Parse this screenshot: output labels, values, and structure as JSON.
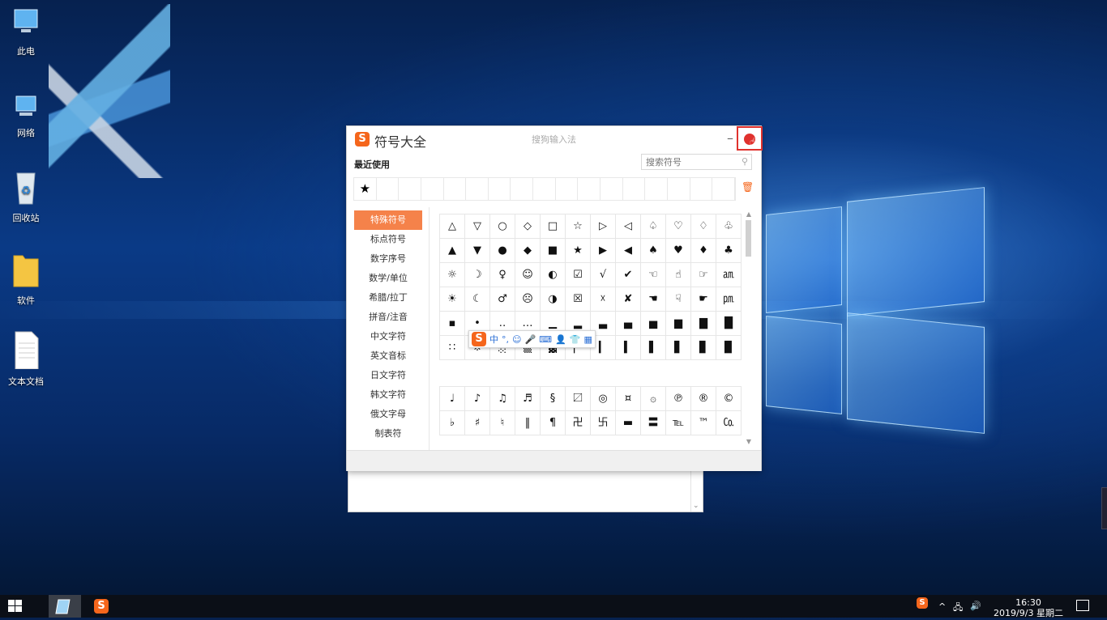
{
  "desktop": {
    "icons": [
      {
        "label": "此电",
        "icon": "computer-icon"
      },
      {
        "label": "网络",
        "icon": "network-icon"
      },
      {
        "label": "回收站",
        "icon": "recycle-bin-icon"
      },
      {
        "label": "软件",
        "icon": "folder-icon"
      },
      {
        "label": "文本文档",
        "icon": "text-document-icon"
      }
    ]
  },
  "dialog": {
    "title": "符号大全",
    "subtitle": "搜狗输入法",
    "logo_letter": "S",
    "minimize": "–",
    "recent_label": "最近使用",
    "search_placeholder": "搜索符号",
    "recent_symbols": [
      "★",
      "",
      "",
      "",
      "",
      "",
      "",
      "",
      "",
      "",
      "",
      "",
      "",
      "",
      "",
      "",
      ""
    ],
    "categories": [
      "特殊符号",
      "标点符号",
      "数字序号",
      "数学/单位",
      "希腊/拉丁",
      "拼音/注音",
      "中文字符",
      "英文音标",
      "日文字符",
      "韩文字符",
      "俄文字母",
      "制表符"
    ],
    "active_category": "特殊符号",
    "symbols_grid_1": [
      [
        "△",
        "▽",
        "○",
        "◇",
        "□",
        "☆",
        "▷",
        "◁",
        "♤",
        "♡",
        "♢",
        "♧"
      ],
      [
        "▲",
        "▼",
        "●",
        "◆",
        "■",
        "★",
        "▶",
        "◀",
        "♠",
        "♥",
        "♦",
        "♣"
      ],
      [
        "☼",
        "☽",
        "♀",
        "☺",
        "◐",
        "☑",
        "√",
        "✔",
        "☜",
        "☝",
        "☞",
        "㏂"
      ],
      [
        "☀",
        "☾",
        "♂",
        "☹",
        "◑",
        "☒",
        "☓",
        "✘",
        "☚",
        "☟",
        "☛",
        "㏘"
      ],
      [
        "▪",
        "•",
        "‥",
        "…",
        "▁",
        "▂",
        "▃",
        "▄",
        "▅",
        "▆",
        "▇",
        "█"
      ],
      [
        "∷",
        "※",
        "░",
        "▒",
        "▓",
        "▏",
        "▎",
        "▍",
        "▌",
        "▋",
        "▊",
        "▉"
      ]
    ],
    "symbols_grid_2": [
      [
        "♩",
        "♪",
        "♫",
        "♬",
        "§",
        "〼",
        "◎",
        "¤",
        "۞",
        "℗",
        "®",
        "©"
      ],
      [
        "♭",
        "♯",
        "♮",
        "‖",
        "¶",
        "卍",
        "卐",
        "▬",
        "〓",
        "℡",
        "™",
        "㏇"
      ]
    ]
  },
  "ime_toolbar": {
    "logo_letter": "S",
    "items": [
      "中",
      "°,",
      "☺",
      "🎤",
      "⌨",
      "👤",
      "👕",
      "▦"
    ]
  },
  "taskbar": {
    "time": "16:30",
    "date": "2019/9/3 星期二",
    "tray_ime": "S",
    "tray_icons": [
      "^",
      "🖧",
      "🔊"
    ]
  }
}
